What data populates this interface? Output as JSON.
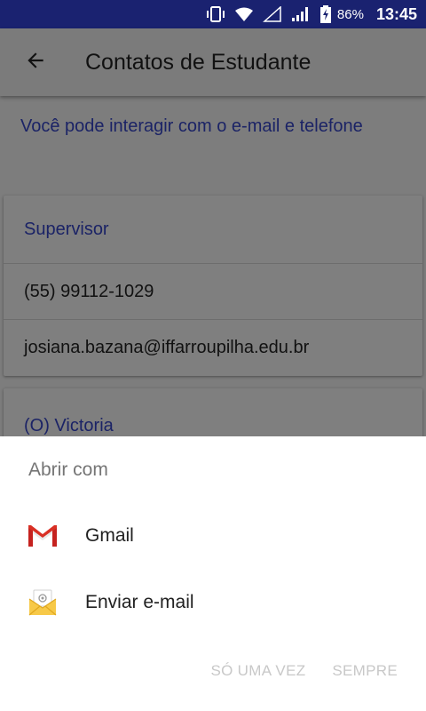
{
  "status_bar": {
    "battery_percent": "86%",
    "time": "13:45",
    "icons": [
      "vibrate-icon",
      "wifi-icon",
      "no-signal-icon",
      "cell-signal-icon",
      "battery-charging-icon"
    ]
  },
  "app_bar": {
    "title": "Contatos de Estudante",
    "back_icon": "arrow-back-icon"
  },
  "info_text": "Você pode interagir com o e-mail e telefone",
  "contacts": [
    {
      "header": "Supervisor",
      "phone": "(55) 99112-1029",
      "email": "josiana.bazana@iffarroupilha.edu.br"
    },
    {
      "header": "(O) Victoria"
    }
  ],
  "chooser": {
    "title": "Abrir com",
    "options": [
      {
        "label": "Gmail",
        "icon": "gmail-icon"
      },
      {
        "label": "Enviar e-mail",
        "icon": "email-envelope-icon"
      }
    ],
    "actions": {
      "once": "SÓ UMA VEZ",
      "always": "SEMPRE"
    }
  },
  "colors": {
    "status_bar": "#1a2270",
    "accent_text": "#1b2366",
    "scrim_background": "#7d7d7d",
    "sheet_background": "#ffffff",
    "disabled_action": "#c8c8c8"
  }
}
